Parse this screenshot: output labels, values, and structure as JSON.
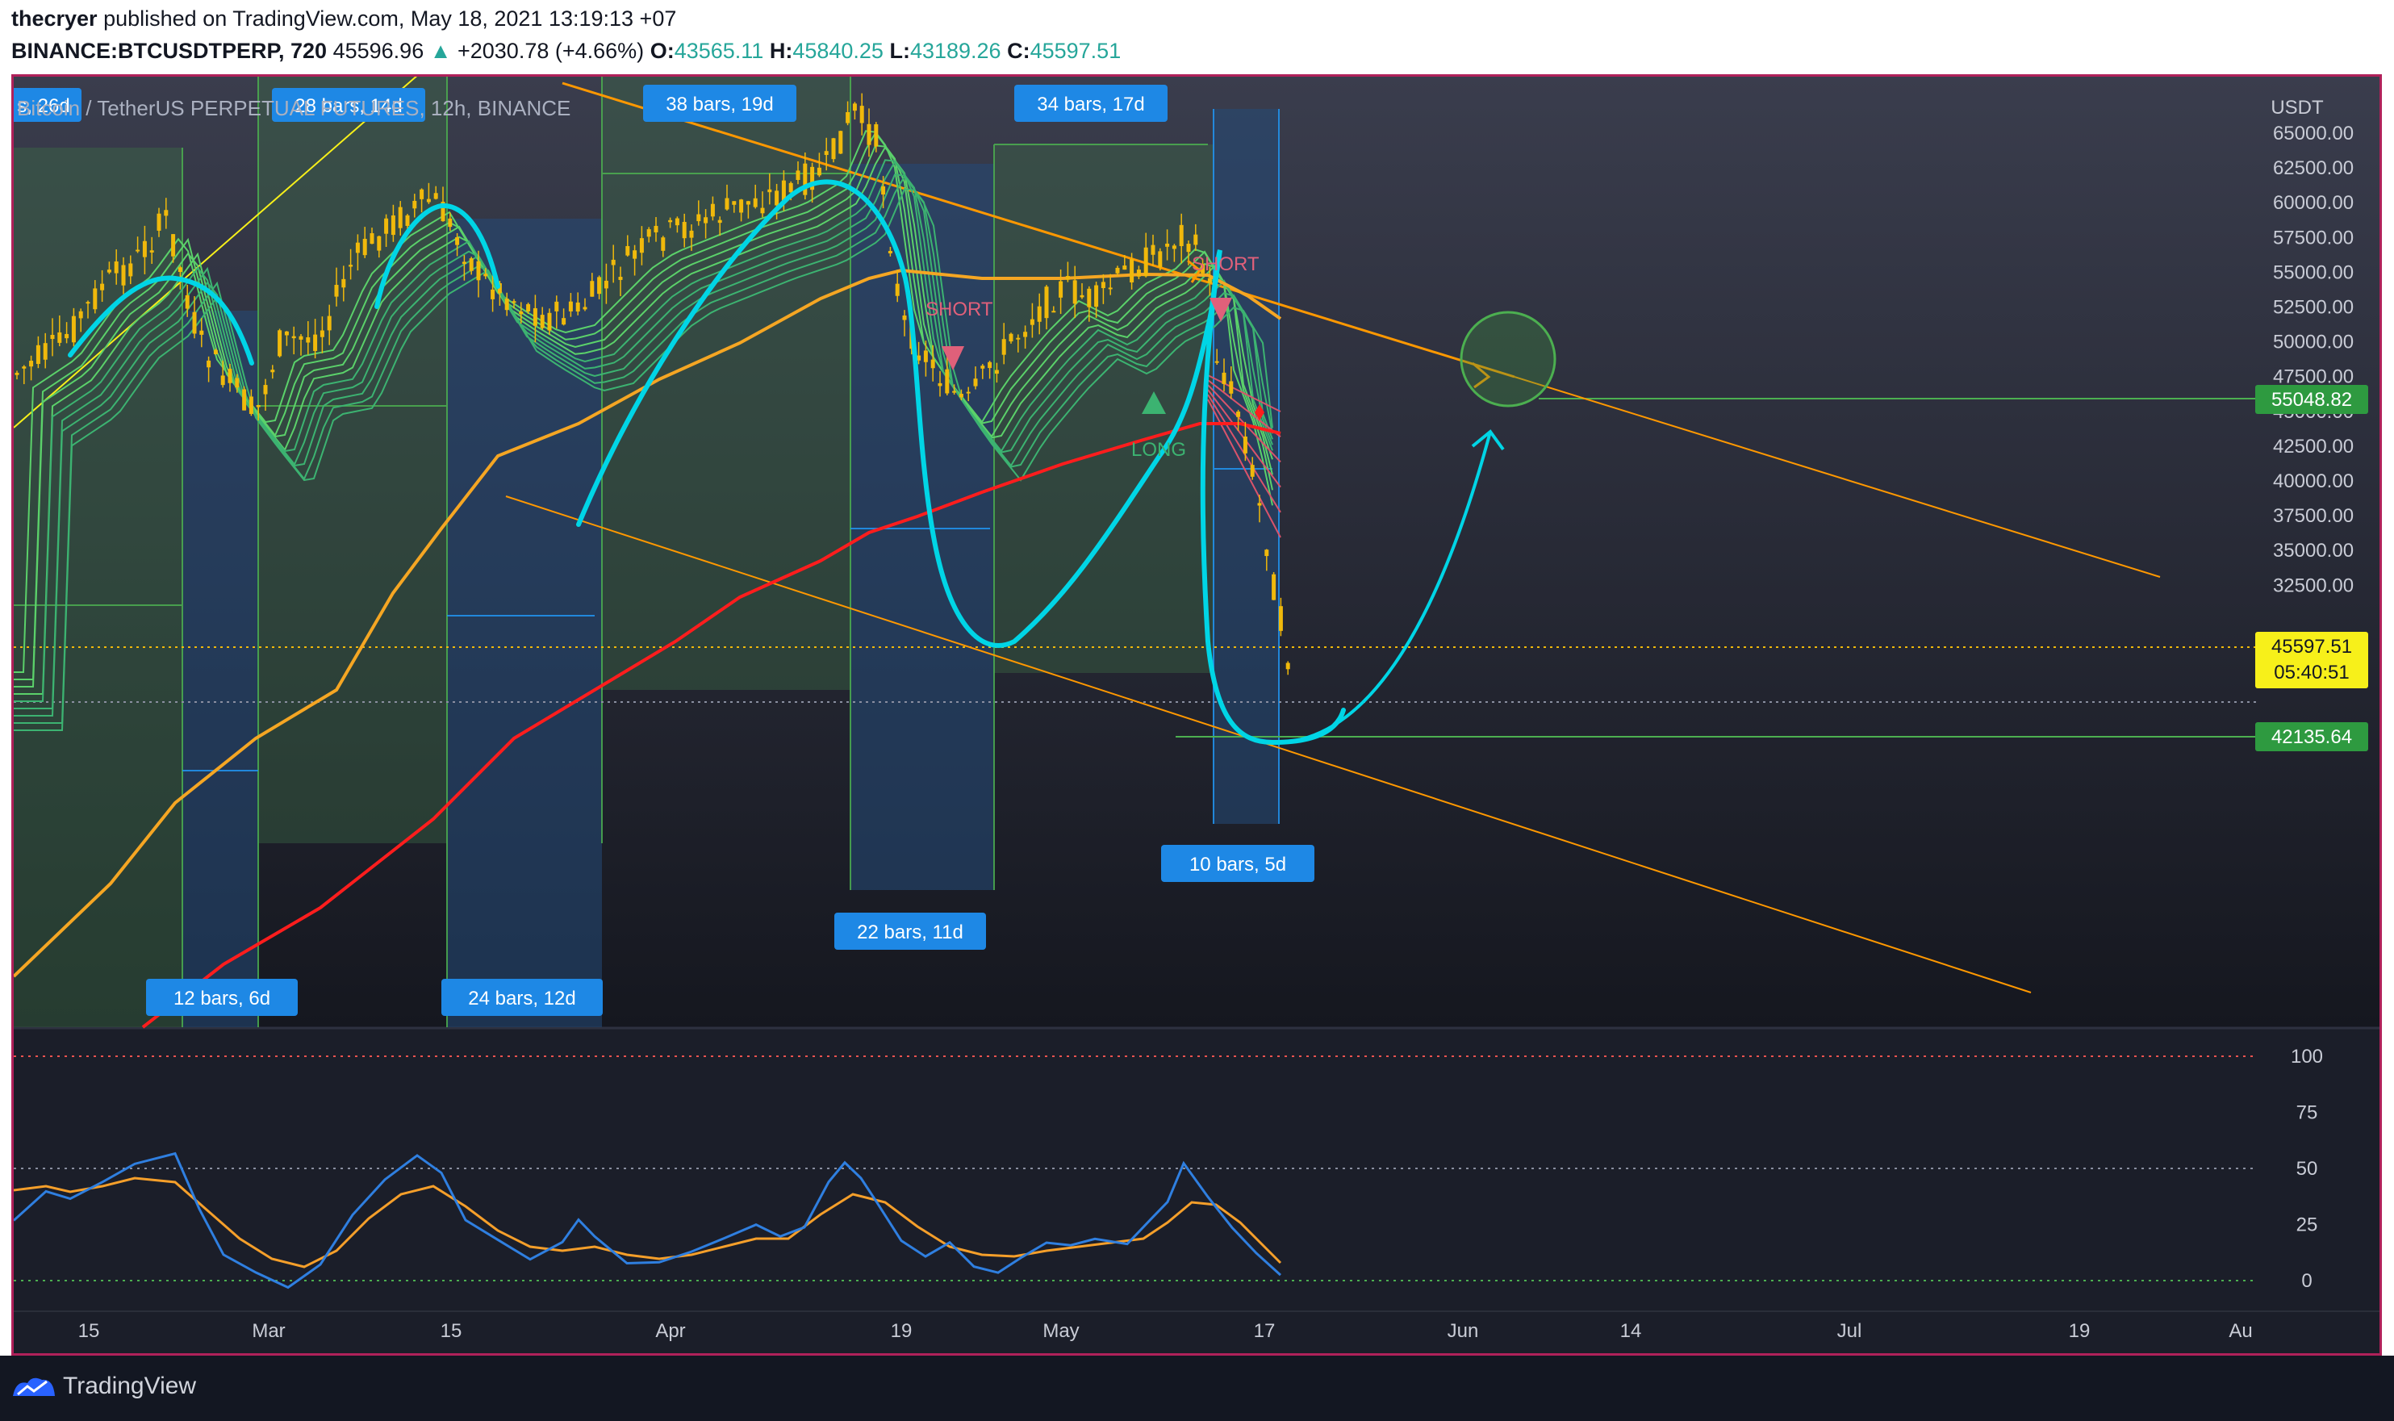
{
  "header": {
    "publisher": "thecryer",
    "published_text": "published on TradingView.com, May 18, 2021 13:19:13 +07",
    "symbol": "BINANCE:BTCUSDTPERP, 720",
    "last_price": "45596.96",
    "change": "+2030.78 (+4.66%)",
    "open_label": "O:",
    "open": "43565.11",
    "high_label": "H:",
    "high": "45840.25",
    "low_label": "L:",
    "low": "43189.26",
    "close_label": "C:",
    "close": "45597.51"
  },
  "chart": {
    "title": "Bitcoin / TetherUS PERPETUAL FUTURES, 12h, BINANCE",
    "currency": "USDT",
    "price_axis": [
      "65000.00",
      "62500.00",
      "60000.00",
      "57500.00",
      "55000.00",
      "52500.00",
      "50000.00",
      "47500.00",
      "45000.00",
      "42500.00",
      "40000.00",
      "37500.00",
      "35000.00",
      "32500.00"
    ],
    "time_axis": [
      "15",
      "Mar",
      "15",
      "Apr",
      "19",
      "May",
      "17",
      "Jun",
      "14",
      "Jul",
      "19",
      "Au"
    ],
    "price_tags": {
      "resistance": "55048.82",
      "current_price": "45597.51",
      "countdown": "05:40:51",
      "support": "42135.64"
    },
    "range_labels": [
      "s, 26d",
      "28 bars, 14d",
      "38 bars, 19d",
      "34 bars, 17d",
      "12 bars, 6d",
      "24 bars, 12d",
      "22 bars, 11d",
      "10 bars, 5d"
    ],
    "signals": [
      "SHORT",
      "SHORT",
      "LONG"
    ],
    "oscillator_axis": [
      "100",
      "75",
      "50",
      "25",
      "0"
    ],
    "colors": {
      "background": "#1d2030",
      "up_candle": "#f0b90b",
      "ma_slow": "#ff1d1d",
      "ma_mid": "#f5a623",
      "ribbon": "#3cb371",
      "trendline": "#ff9800",
      "drawing": "#00d5e6",
      "range_green": "#2e5f3c",
      "range_blue": "#1f3f6a",
      "tag_green": "#2e9a40",
      "tag_yellow": "#f7f01a",
      "stoch_k": "#2f7fe0",
      "stoch_d": "#f59f2a"
    }
  },
  "footer": {
    "brand": "TradingView"
  }
}
